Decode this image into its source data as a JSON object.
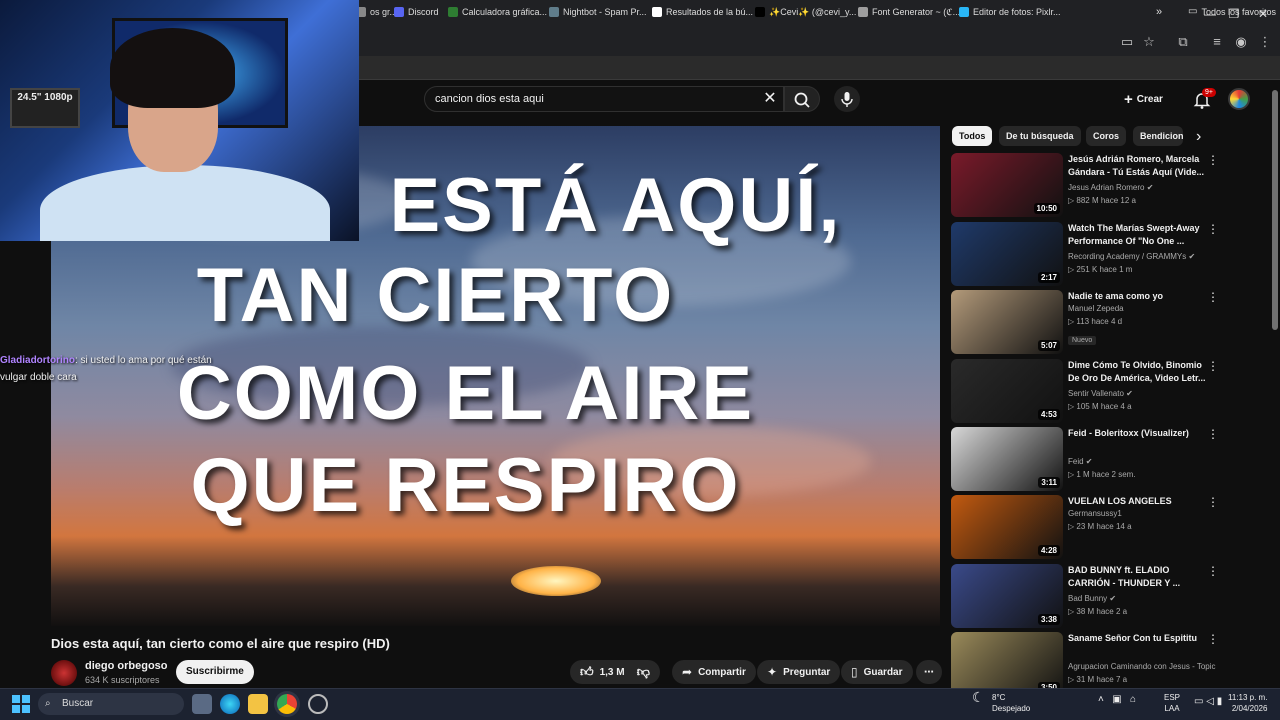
{
  "window": {
    "minimize": "—",
    "maximize": "❐",
    "close": "✕"
  },
  "bookmarks": [
    {
      "label": "os gr...",
      "color": "#888"
    },
    {
      "label": "Discord",
      "color": "#5865f2"
    },
    {
      "label": "Calculadora gráfica...",
      "color": "#2e7d32"
    },
    {
      "label": "Nightbot - Spam Pr...",
      "color": "#607d8b"
    },
    {
      "label": "Resultados de la bú...",
      "color": "#ffffff"
    },
    {
      "label": "✨Cevi✨ (@cevi_y...",
      "color": "#000000"
    },
    {
      "label": "Font Generator ~ (ℭ...",
      "color": "#9e9e9e"
    },
    {
      "label": "Editor de fotos: Pixlr...",
      "color": "#29b6f6"
    }
  ],
  "bookmarks_all": "Todos los favoritos",
  "search": {
    "query": "cancion dios esta aqui"
  },
  "header": {
    "create_label": "Crear",
    "notif_count": "9+"
  },
  "player": {
    "lyrics": [
      "ESTÁ AQUÍ,",
      "TAN CIERTO",
      "COMO EL AIRE",
      "QUE RESPIRO"
    ]
  },
  "webcam": {
    "monitor_text": "24.5\" 1080p"
  },
  "chat": {
    "user": "Gladiadortorino",
    "message": ": si usted lo ama por qué están vulgar doble cara"
  },
  "video": {
    "title": "Dios esta aquí, tan cierto como el aire que respiro (HD)",
    "channel": "diego orbegoso",
    "subscribers": "634 K suscriptores",
    "subscribe_label": "Suscribirme",
    "likes": "1,3 M",
    "share_label": "Compartir",
    "ask_label": "Preguntar",
    "save_label": "Guardar"
  },
  "chips": [
    "Todos",
    "De tu búsqueda",
    "Coros",
    "Bendicione"
  ],
  "recommendations": [
    {
      "title": "Jesús Adrián Romero, Marcela Gándara - Tú Estás Aquí (Vide...",
      "channel": "Jesus Adrian Romero",
      "verified": true,
      "views": "882 M",
      "age": "hace 12 a",
      "duration": "10:50",
      "thumb": "#7a1a2a"
    },
    {
      "title": "Watch The Marías Swept-Away Performance Of \"No One ...",
      "channel": "Recording Academy / GRAMMYs",
      "verified": true,
      "views": "251 K",
      "age": "hace 1 m",
      "duration": "2:17",
      "thumb": "#1f3a6a"
    },
    {
      "title": "Nadie te ama como yo",
      "channel": "Manuel Zepeda",
      "verified": false,
      "views": "113",
      "age": "hace 4 d",
      "duration": "5:07",
      "badge": "Nuevo",
      "thumb": "#b39a7a"
    },
    {
      "title": "Dime Cómo Te Olvido, Binomio De Oro De América, Video Letr...",
      "channel": "Sentir Vallenato",
      "verified": true,
      "views": "105 M",
      "age": "hace 4 a",
      "duration": "4:53",
      "thumb": "#2a2a2a"
    },
    {
      "title": "Feid - Boleritoxx (Visualizer)",
      "channel": "Feid",
      "verified": true,
      "views": "1 M",
      "age": "hace 2 sem.",
      "duration": "3:11",
      "thumb": "#d8d8d8"
    },
    {
      "title": "VUELAN LOS ANGELES",
      "channel": "Germansussy1",
      "verified": false,
      "views": "23 M",
      "age": "hace 14 a",
      "duration": "4:28",
      "thumb": "#c25a10"
    },
    {
      "title": "BAD BUNNY ft. ELADIO CARRIÓN - THUNDER Y ...",
      "channel": "Bad Bunny",
      "verified": true,
      "views": "38 M",
      "age": "hace 2 a",
      "duration": "3:38",
      "thumb": "#3a4a8a"
    },
    {
      "title": "Sanamе Señor Con tu Espititu",
      "channel": "Agrupacion Caminando con Jesus - Topic",
      "verified": false,
      "views": "31 M",
      "age": "hace 7 a",
      "duration": "3:50",
      "thumb": "#9a8a5a"
    }
  ],
  "taskbar": {
    "search_label": "Buscar",
    "weather_temp": "8°C",
    "weather_desc": "Despejado",
    "lang_1": "ESP",
    "lang_2": "LAA",
    "time": "11:13 p. m.",
    "date": "2/04/2026"
  }
}
